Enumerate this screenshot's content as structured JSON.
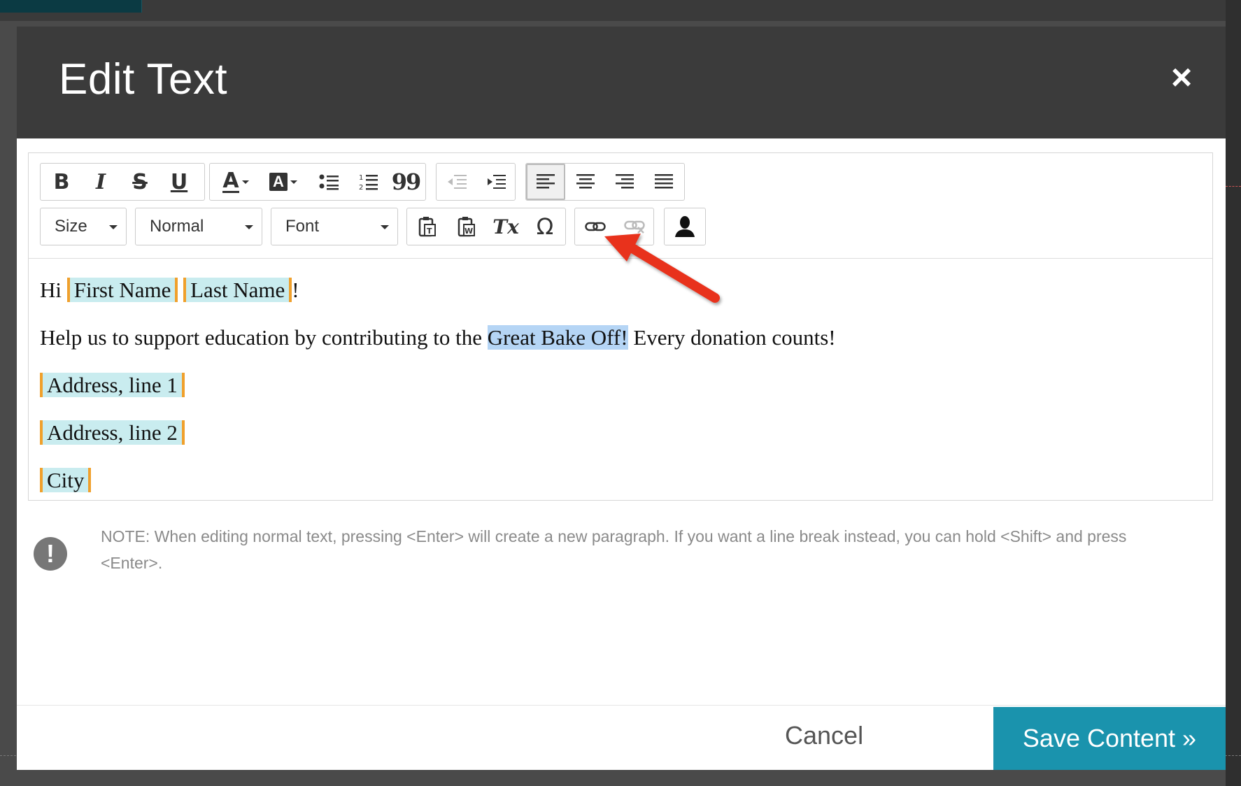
{
  "modal": {
    "title": "Edit Text",
    "close_label": "×"
  },
  "toolbar": {
    "size_label": "Size",
    "format_label": "Normal",
    "font_label": "Font",
    "bold_glyph": "B",
    "italic_glyph": "I",
    "strike_glyph": "S",
    "underline_glyph": "U",
    "text_color_glyph": "A",
    "bg_color_glyph": "A",
    "blockquote_glyph": "99",
    "remove_format_glyph": "Tx",
    "special_char_glyph": "Ω"
  },
  "content": {
    "p1_prefix": "Hi ",
    "first_name": "First Name",
    "last_name": "Last Name",
    "p1_suffix": "!",
    "p2_prefix": "Help us to support education by contributing to the ",
    "p2_highlight": "Great Bake Off!",
    "p2_suffix": " Every donation counts!",
    "address1": "Address, line 1",
    "address2": "Address, line 2",
    "city": "City"
  },
  "note": {
    "icon": "!",
    "text": "NOTE: When editing normal text, pressing <Enter> will create a new paragraph. If you want a line break instead, you can hold <Shift> and press <Enter>."
  },
  "footer": {
    "cancel_label": "Cancel",
    "save_label": "Save Content »"
  },
  "colors": {
    "header_bg": "#3b3b3b",
    "save_button": "#1a93ad",
    "merge_tag_bg": "#c9ecef",
    "merge_tag_border": "#f0a02c",
    "selection_bg": "#b5d5f5",
    "annotation_arrow": "#e8321e"
  }
}
